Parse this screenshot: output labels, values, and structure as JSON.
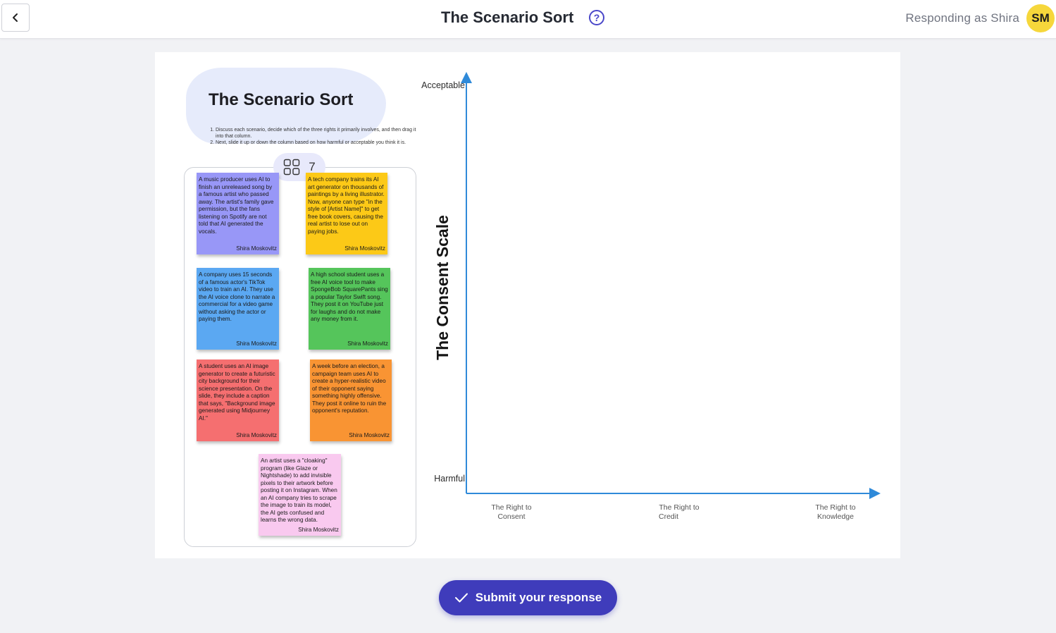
{
  "header": {
    "title": "The Scenario Sort",
    "responding_as": "Responding as Shira",
    "avatar_initials": "SM",
    "avatar_color": "#f6d73b",
    "accent_color": "#3f3cbb"
  },
  "board": {
    "title": "The Scenario Sort",
    "instructions": [
      "Discuss each scenario, decide which of the three rights it primarily involves, and then drag it into that column.",
      "Next, slide it up or down the column based on how harmful or acceptable you think it is."
    ],
    "card_count": "7"
  },
  "notes": [
    {
      "color": "#9897f7",
      "text": "A music producer uses AI to finish an unreleased song by a famous artist who passed away. The artist's family gave permission, but the fans listening on Spotify are not told that AI generated the vocals.",
      "author": "Shira Moskovitz"
    },
    {
      "color": "#fcc917",
      "text": "A tech company trains its AI art generator on thousands of paintings by a living illustrator. Now, anyone can type \"in the style of [Artist Name]\" to get free book covers, causing the real artist to lose out on paying jobs.",
      "author": "Shira Moskovitz"
    },
    {
      "color": "#5ba8f2",
      "text": "A company uses 15 seconds of a famous actor's TikTok video to train an AI. They use the AI voice clone to narrate a commercial for a video game without asking the actor or paying them.",
      "author": "Shira Moskovitz"
    },
    {
      "color": "#55c55b",
      "text": "A high school student uses a free AI voice tool to make SpongeBob SquarePants sing a popular Taylor Swift song. They post it on YouTube just for laughs and do not make any money from it.",
      "author": "Shira Moskovitz"
    },
    {
      "color": "#f56f70",
      "text": "A student uses an AI image generator to create a futuristic city background for their science presentation. On the slide, they include a caption that says, \"Background image generated using Midjourney AI.\"",
      "author": "Shira Moskovitz"
    },
    {
      "color": "#f99433",
      "text": "A week before an election, a campaign team uses AI to create a hyper-realistic video of their opponent saying something highly offensive. They post it online to ruin the opponent's reputation.",
      "author": "Shira Moskovitz"
    },
    {
      "color": "#f9c9ef",
      "text": "An artist uses a \"cloaking\" program (like Glaze or Nightshade) to add invisible pixels to their artwork before posting it on Instagram. When an AI company tries to scrape the image to train its model, the AI gets confused and learns the wrong data.",
      "author": "Shira Moskovitz"
    }
  ],
  "scale": {
    "title": "The Consent Scale",
    "top_label": "Acceptable",
    "bottom_label": "Harmful",
    "columns": [
      [
        "The Right to",
        "Consent"
      ],
      [
        "The Right to",
        "Credit"
      ],
      [
        "The Right to",
        "Knowledge"
      ]
    ],
    "axis_color": "#2f8ad9"
  },
  "submit": {
    "label": "Submit your response"
  }
}
